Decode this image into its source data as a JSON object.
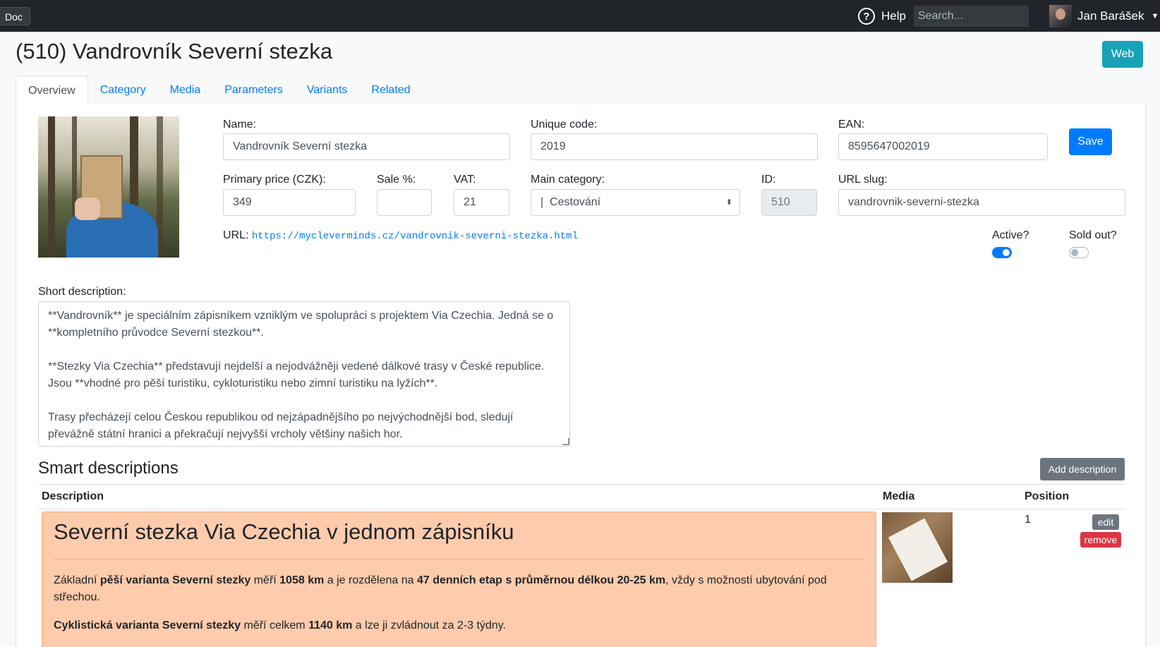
{
  "topbar": {
    "doc_label": "Doc",
    "help_label": "Help",
    "search_placeholder": "Search...",
    "user_name": "Jan Barášek"
  },
  "page": {
    "title": "(510) Vandrovník Severní stezka",
    "web_button": "Web"
  },
  "tabs": [
    {
      "label": "Overview",
      "active": true
    },
    {
      "label": "Category"
    },
    {
      "label": "Media"
    },
    {
      "label": "Parameters"
    },
    {
      "label": "Variants"
    },
    {
      "label": "Related"
    }
  ],
  "form": {
    "name_label": "Name:",
    "name_value": "Vandrovník Severní stezka",
    "unique_code_label": "Unique code:",
    "unique_code_value": "2019",
    "ean_label": "EAN:",
    "ean_value": "8595647002019",
    "save_label": "Save",
    "primary_price_label": "Primary price (CZK):",
    "primary_price_value": "349",
    "sale_label": "Sale %:",
    "sale_value": "",
    "vat_label": "VAT:",
    "vat_value": "21",
    "main_category_label": "Main category:",
    "main_category_value": "|  Cestování",
    "id_label": "ID:",
    "id_value": "510",
    "url_slug_label": "URL slug:",
    "url_slug_value": "vandrovnik-severni-stezka",
    "url_label": "URL:",
    "url_value": "https://mycleverminds.cz/vandrovnik-severni-stezka.html",
    "active_label": "Active?",
    "active_value": true,
    "sold_out_label": "Sold out?",
    "sold_out_value": false,
    "short_desc_label": "Short description:",
    "short_desc_value": "**Vandrovník** je speciálním zápisníkem vzniklým ve spolupráci s projektem Via Czechia. Jedná se o **kompletního průvodce Severní stezkou**.\n\n**Stezky Via Czechia** představují nejdelší a nejodvážněji vedené dálkové trasy v České republice. Jsou **vhodné pro pěší turistiku, cykloturistiku nebo zimní turistiku na lyžích**.\n\nTrasy přecházejí celou Českou republikou od nejzápadnějšího po nejvýchodnější bod, sledují převážně státní hranici a překračují nejvyšší vrcholy většiny našich hor."
  },
  "smart": {
    "title": "Smart descriptions",
    "add_button": "Add description",
    "columns": {
      "description": "Description",
      "media": "Media",
      "position": "Position"
    },
    "rows": [
      {
        "heading": "Severní stezka Via Czechia v jednom zápisníku",
        "p1": {
          "t1": "Základní ",
          "b1": "pěší varianta Severní stezky",
          "t2": " měří ",
          "b2": "1058 km",
          "t3": " a je rozdělena na ",
          "b3": "47 denních etap s průměrnou délkou 20-25 km",
          "t4": ", vždy s možností ubytování pod střechou."
        },
        "p2": {
          "b1": "Cyklistická varianta Severní stezky",
          "t1": " měří celkem ",
          "b2": "1140 km",
          "t2": " a lze ji zvládnout za 2-3 týdny."
        },
        "position": "1",
        "edit": "edit",
        "remove": "remove"
      }
    ]
  },
  "colors": {
    "topbar": "#212529",
    "primary": "#007bff",
    "info": "#17a2b8",
    "danger": "#dc3545",
    "secondary": "#6c757d",
    "desc_bg": "#fecbac"
  }
}
